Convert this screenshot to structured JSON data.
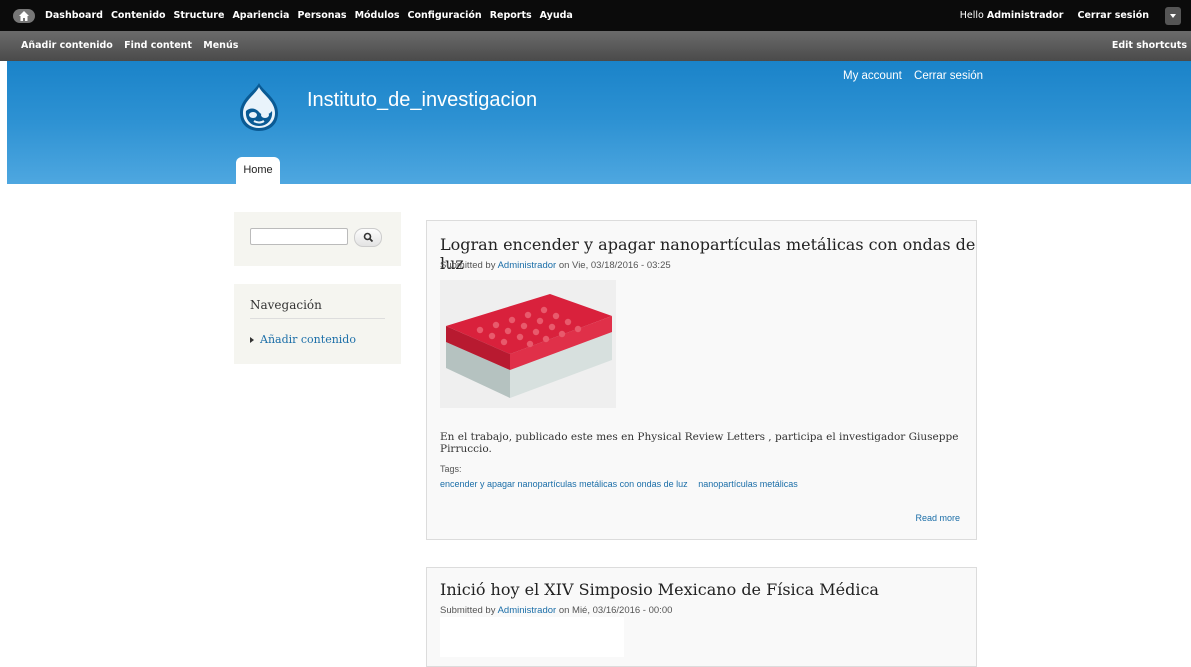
{
  "toolbar": {
    "home_icon": "home-icon",
    "menu": [
      "Dashboard",
      "Contenido",
      "Structure",
      "Apariencia",
      "Personas",
      "Módulos",
      "Configuración",
      "Reports",
      "Ayuda"
    ],
    "hello_prefix": "Hello",
    "user": "Administrador",
    "logout": "Cerrar sesión"
  },
  "shortcuts": {
    "items": [
      "Añadir contenido",
      "Find content",
      "Menús"
    ],
    "edit": "Edit shortcuts"
  },
  "header": {
    "site_name": "Instituto_de_investigacion",
    "secondary_menu": [
      "My account",
      "Cerrar sesión"
    ],
    "home_tab": "Home"
  },
  "sidebar": {
    "search_value": "",
    "nav_title": "Navegación",
    "nav_items": [
      "Añadir contenido"
    ]
  },
  "articles": [
    {
      "title": "Logran encender y apagar nanopartículas metálicas con ondas de luz",
      "submitted_prefix": "Submitted by",
      "author": "Administrador",
      "date": "on Vie, 03/18/2016 - 03:25",
      "body": "En el trabajo, publicado este mes en Physical Review Letters , participa el investigador Giuseppe Pirruccio.",
      "tags_label": "Tags:",
      "tags": [
        "encender y apagar nanopartículas metálicas con ondas de luz",
        "nanopartículas metálicas"
      ],
      "read_more": "Read more"
    },
    {
      "title": "Inició hoy el XIV Simposio Mexicano de Física Médica",
      "submitted_prefix": "Submitted by",
      "author": "Administrador",
      "date": "on Mié, 03/16/2016 - 00:00"
    }
  ],
  "colors": {
    "toolbar": "#0b0b0b",
    "header_blue": "#2e92d3",
    "link": "#1b6ea8"
  }
}
